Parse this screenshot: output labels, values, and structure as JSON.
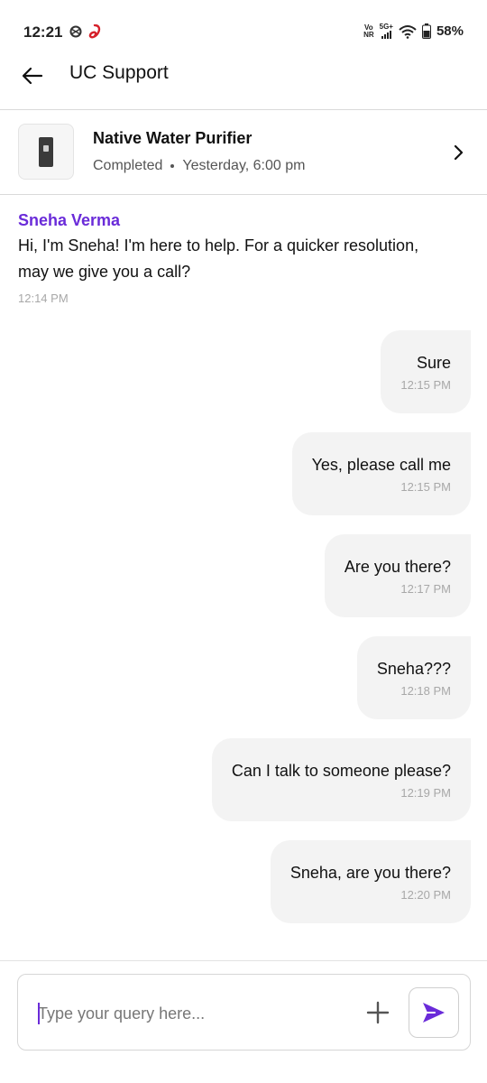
{
  "status_bar": {
    "time": "12:21",
    "volte_top": "Vo",
    "volte_bottom": "NR",
    "network_type": "5G+",
    "battery_percent": "58%",
    "icons": [
      "settings-sync-icon",
      "airtel-logo-icon",
      "signal-icon",
      "wifi-icon",
      "battery-icon"
    ]
  },
  "header": {
    "title": "UC Support",
    "back_icon": "arrow-left-icon"
  },
  "booking": {
    "product_name": "Native Water Purifier",
    "status": "Completed",
    "datetime": "Yesterday, 6:00 pm",
    "chevron_icon": "chevron-right-icon"
  },
  "agent_message": {
    "sender": "Sneha Verma",
    "text": "Hi, I'm Sneha! I'm here to help. For a quicker resolution, may we give you a call?",
    "time": "12:14 PM"
  },
  "user_messages": [
    {
      "text": "Sure",
      "time": "12:15 PM"
    },
    {
      "text": "Yes, please call me",
      "time": "12:15 PM"
    },
    {
      "text": "Are you there?",
      "time": "12:17 PM"
    },
    {
      "text": "Sneha???",
      "time": "12:18 PM"
    },
    {
      "text": "Can I talk to someone please?",
      "time": "12:19 PM"
    },
    {
      "text": "Sneha, are you there?",
      "time": "12:20 PM"
    }
  ],
  "composer": {
    "placeholder": "Type your query here...",
    "value": "",
    "attach_icon": "plus-icon",
    "send_icon": "send-icon"
  },
  "colors": {
    "accent": "#6a2bd9",
    "bubble_bg": "#f3f3f3",
    "timestamp": "#a8a8a8",
    "divider": "#d9d9d9"
  }
}
